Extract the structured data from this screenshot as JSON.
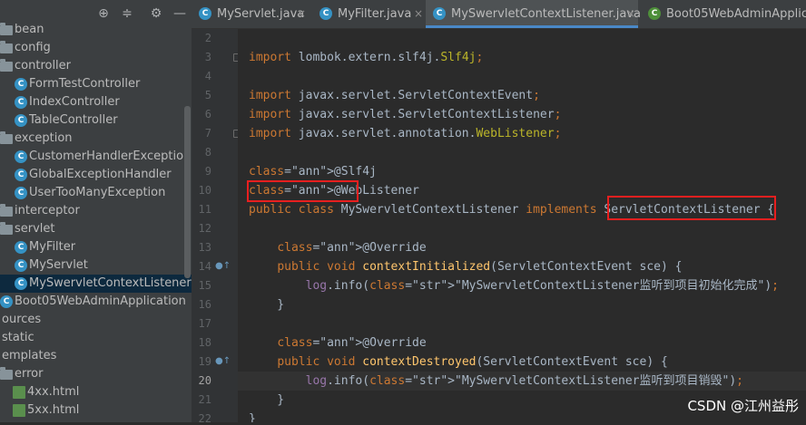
{
  "toolbar": {
    "icons": [
      "crosshair-icon",
      "collapse-icon",
      "gear-icon",
      "minimize-icon"
    ]
  },
  "tree": {
    "items": [
      {
        "label": "bean",
        "kind": "folder"
      },
      {
        "label": "config",
        "kind": "folder"
      },
      {
        "label": "controller",
        "kind": "folder"
      },
      {
        "label": "FormTestController",
        "kind": "class"
      },
      {
        "label": "IndexController",
        "kind": "class"
      },
      {
        "label": "TableController",
        "kind": "class"
      },
      {
        "label": "exception",
        "kind": "folder"
      },
      {
        "label": "CustomerHandlerExceptionRes",
        "kind": "class"
      },
      {
        "label": "GlobalExceptionHandler",
        "kind": "class"
      },
      {
        "label": "UserTooManyException",
        "kind": "class"
      },
      {
        "label": "interceptor",
        "kind": "folder"
      },
      {
        "label": "servlet",
        "kind": "folder"
      },
      {
        "label": "MyFilter",
        "kind": "class"
      },
      {
        "label": "MyServlet",
        "kind": "class"
      },
      {
        "label": "MySwervletContextListener",
        "kind": "class",
        "selected": true
      },
      {
        "label": "Boot05WebAdminApplication",
        "kind": "class"
      },
      {
        "label": "ources",
        "kind": "folder"
      },
      {
        "label": "static",
        "kind": "folder"
      },
      {
        "label": "emplates",
        "kind": "folder"
      },
      {
        "label": "error",
        "kind": "folder"
      },
      {
        "label": "4xx.html",
        "kind": "html"
      },
      {
        "label": "5xx.html",
        "kind": "html"
      }
    ]
  },
  "tabs": [
    {
      "label": "MyServlet.java",
      "active": false
    },
    {
      "label": "MyFilter.java",
      "active": false
    },
    {
      "label": "MySwervletContextListener.java",
      "active": true
    },
    {
      "label": "Boot05WebAdminApplicatio",
      "active": false
    }
  ],
  "tab_close_glyph": "×",
  "editor": {
    "current_line": "20",
    "lines": [
      {
        "n": "2",
        "text": ""
      },
      {
        "n": "3",
        "text": "import lombok.extern.slf4j.Slf4j;"
      },
      {
        "n": "4",
        "text": ""
      },
      {
        "n": "5",
        "text": "import javax.servlet.ServletContextEvent;"
      },
      {
        "n": "6",
        "text": "import javax.servlet.ServletContextListener;"
      },
      {
        "n": "7",
        "text": "import javax.servlet.annotation.WebListener;"
      },
      {
        "n": "8",
        "text": ""
      },
      {
        "n": "9",
        "text": "@Slf4j"
      },
      {
        "n": "10",
        "text": "@WebListener"
      },
      {
        "n": "11",
        "text": "public class MySwervletContextListener implements ServletContextListener {"
      },
      {
        "n": "12",
        "text": ""
      },
      {
        "n": "13",
        "text": "    @Override"
      },
      {
        "n": "14",
        "text": "    public void contextInitialized(ServletContextEvent sce) {"
      },
      {
        "n": "15",
        "text": "        log.info(\"MySwervletContextListener监听到项目初始化完成\");"
      },
      {
        "n": "16",
        "text": "    }"
      },
      {
        "n": "17",
        "text": ""
      },
      {
        "n": "18",
        "text": "    @Override"
      },
      {
        "n": "19",
        "text": "    public void contextDestroyed(ServletContextEvent sce) {"
      },
      {
        "n": "20",
        "text": "        log.info(\"MySwervletContextListener监听到项目销毁\");"
      },
      {
        "n": "21",
        "text": "    }"
      },
      {
        "n": "22",
        "text": "}"
      }
    ]
  },
  "watermark": "CSDN @江州益彤",
  "colors": {
    "highlight_box": "#e81f1f",
    "keyword": "#cc7832",
    "annotation": "#bbb529",
    "string": "#6a8759"
  }
}
